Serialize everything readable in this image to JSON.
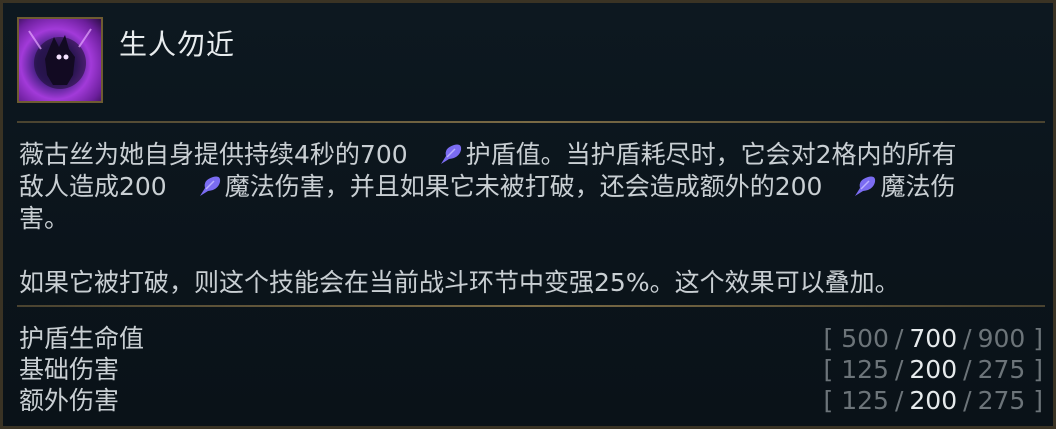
{
  "ability": {
    "name": "生人勿近",
    "icon": "shield-silhouette-icon"
  },
  "description": {
    "line1_a": "薇古丝为她自身提供持续4秒的700",
    "line1_b": "护盾值。当护盾耗尽时，它会对2格内的所有",
    "line2_a": "敌人造成200",
    "line2_b": "魔法伤害，并且如果它未被打破，还会造成额外的200",
    "line2_c": "魔法伤",
    "line3": "害。",
    "paragraph2": "如果它被打破，则这个技能会在当前战斗环节中变强25%。这个效果可以叠加。",
    "icon": "ability-power-icon"
  },
  "stats": [
    {
      "label": "护盾生命值",
      "values": [
        "500",
        "700",
        "900"
      ],
      "active": 1
    },
    {
      "label": "基础伤害",
      "values": [
        "125",
        "200",
        "275"
      ],
      "active": 1
    },
    {
      "label": "额外伤害",
      "values": [
        "125",
        "200",
        "275"
      ],
      "active": 1
    }
  ],
  "brackets": {
    "open": "[",
    "close": "]",
    "sep": "/"
  },
  "colors": {
    "accent_icon": "#7b6cf2",
    "border": "#6e5b32"
  }
}
